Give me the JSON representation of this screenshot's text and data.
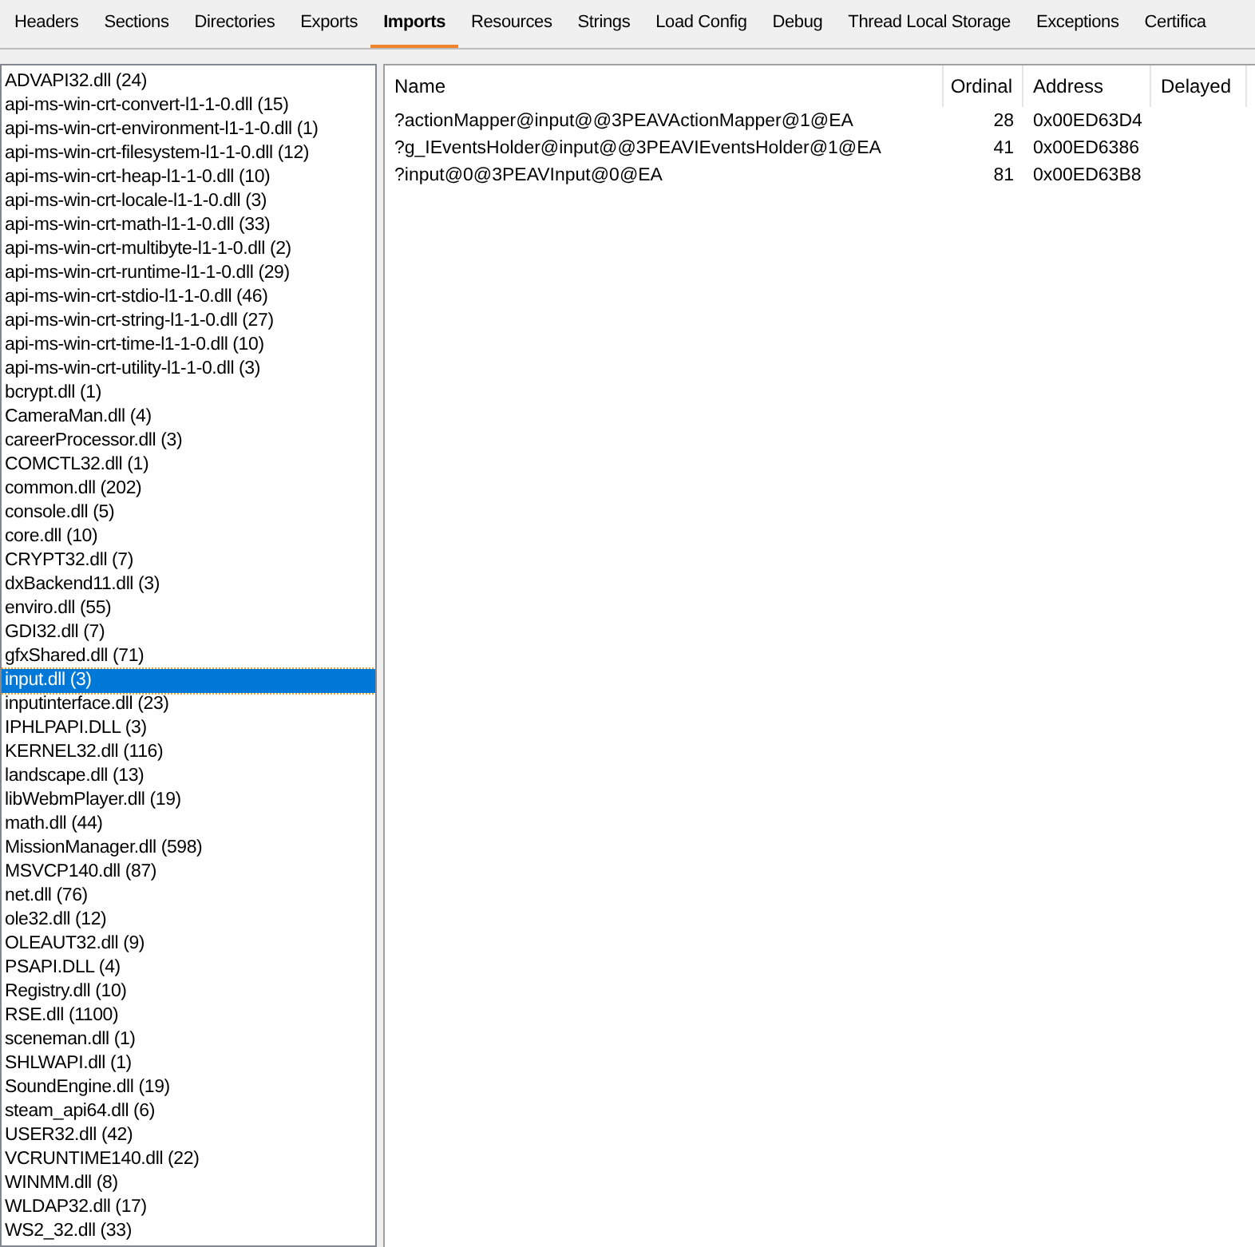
{
  "tabs": [
    {
      "label": "Headers",
      "selected": false
    },
    {
      "label": "Sections",
      "selected": false
    },
    {
      "label": "Directories",
      "selected": false
    },
    {
      "label": "Exports",
      "selected": false
    },
    {
      "label": "Imports",
      "selected": true
    },
    {
      "label": "Resources",
      "selected": false
    },
    {
      "label": "Strings",
      "selected": false
    },
    {
      "label": "Load Config",
      "selected": false
    },
    {
      "label": "Debug",
      "selected": false
    },
    {
      "label": "Thread Local Storage",
      "selected": false
    },
    {
      "label": "Exceptions",
      "selected": false
    },
    {
      "label": "Certifica",
      "selected": false
    }
  ],
  "modules": [
    {
      "label": "ADVAPI32.dll (24)",
      "selected": false
    },
    {
      "label": "api-ms-win-crt-convert-l1-1-0.dll (15)",
      "selected": false
    },
    {
      "label": "api-ms-win-crt-environment-l1-1-0.dll (1)",
      "selected": false
    },
    {
      "label": "api-ms-win-crt-filesystem-l1-1-0.dll (12)",
      "selected": false
    },
    {
      "label": "api-ms-win-crt-heap-l1-1-0.dll (10)",
      "selected": false
    },
    {
      "label": "api-ms-win-crt-locale-l1-1-0.dll (3)",
      "selected": false
    },
    {
      "label": "api-ms-win-crt-math-l1-1-0.dll (33)",
      "selected": false
    },
    {
      "label": "api-ms-win-crt-multibyte-l1-1-0.dll (2)",
      "selected": false
    },
    {
      "label": "api-ms-win-crt-runtime-l1-1-0.dll (29)",
      "selected": false
    },
    {
      "label": "api-ms-win-crt-stdio-l1-1-0.dll (46)",
      "selected": false
    },
    {
      "label": "api-ms-win-crt-string-l1-1-0.dll (27)",
      "selected": false
    },
    {
      "label": "api-ms-win-crt-time-l1-1-0.dll (10)",
      "selected": false
    },
    {
      "label": "api-ms-win-crt-utility-l1-1-0.dll (3)",
      "selected": false
    },
    {
      "label": "bcrypt.dll (1)",
      "selected": false
    },
    {
      "label": "CameraMan.dll (4)",
      "selected": false
    },
    {
      "label": "careerProcessor.dll (3)",
      "selected": false
    },
    {
      "label": "COMCTL32.dll (1)",
      "selected": false
    },
    {
      "label": "common.dll (202)",
      "selected": false
    },
    {
      "label": "console.dll (5)",
      "selected": false
    },
    {
      "label": "core.dll (10)",
      "selected": false
    },
    {
      "label": "CRYPT32.dll (7)",
      "selected": false
    },
    {
      "label": "dxBackend11.dll (3)",
      "selected": false
    },
    {
      "label": "enviro.dll (55)",
      "selected": false
    },
    {
      "label": "GDI32.dll (7)",
      "selected": false
    },
    {
      "label": "gfxShared.dll (71)",
      "selected": false
    },
    {
      "label": "input.dll (3)",
      "selected": true
    },
    {
      "label": "inputinterface.dll (23)",
      "selected": false
    },
    {
      "label": "IPHLPAPI.DLL (3)",
      "selected": false
    },
    {
      "label": "KERNEL32.dll (116)",
      "selected": false
    },
    {
      "label": "landscape.dll (13)",
      "selected": false
    },
    {
      "label": "libWebmPlayer.dll (19)",
      "selected": false
    },
    {
      "label": "math.dll (44)",
      "selected": false
    },
    {
      "label": "MissionManager.dll (598)",
      "selected": false
    },
    {
      "label": "MSVCP140.dll (87)",
      "selected": false
    },
    {
      "label": "net.dll (76)",
      "selected": false
    },
    {
      "label": "ole32.dll (12)",
      "selected": false
    },
    {
      "label": "OLEAUT32.dll (9)",
      "selected": false
    },
    {
      "label": "PSAPI.DLL (4)",
      "selected": false
    },
    {
      "label": "Registry.dll (10)",
      "selected": false
    },
    {
      "label": "RSE.dll (1100)",
      "selected": false
    },
    {
      "label": "sceneman.dll (1)",
      "selected": false
    },
    {
      "label": "SHLWAPI.dll (1)",
      "selected": false
    },
    {
      "label": "SoundEngine.dll (19)",
      "selected": false
    },
    {
      "label": "steam_api64.dll (6)",
      "selected": false
    },
    {
      "label": "USER32.dll (42)",
      "selected": false
    },
    {
      "label": "VCRUNTIME140.dll (22)",
      "selected": false
    },
    {
      "label": "WINMM.dll (8)",
      "selected": false
    },
    {
      "label": "WLDAP32.dll (17)",
      "selected": false
    },
    {
      "label": "WS2_32.dll (33)",
      "selected": false
    }
  ],
  "table": {
    "columns": [
      "Name",
      "Ordinal",
      "Address",
      "Delayed"
    ],
    "rows": [
      [
        "?actionMapper@input@@3PEAVActionMapper@1@EA",
        "28",
        "0x00ED63D4"
      ],
      [
        "?g_IEventsHolder@input@@3PEAVIEventsHolder@1@EA",
        "41",
        "0x00ED6386"
      ],
      [
        "?input@0@3PEAVInput@0@EA",
        "81",
        "0x00ED63B8"
      ]
    ]
  }
}
